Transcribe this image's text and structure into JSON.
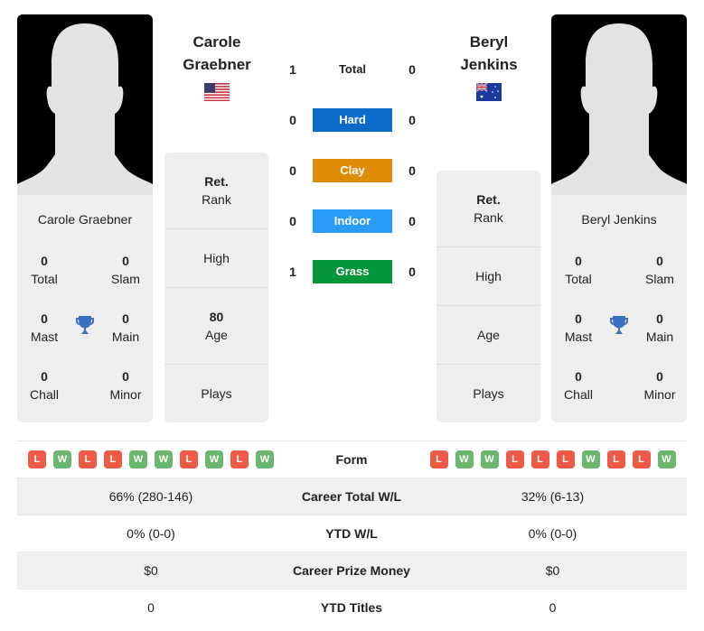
{
  "players": {
    "left": {
      "name": "Carole Graebner",
      "name_line1": "Carole",
      "name_line2": "Graebner",
      "flag": "us-flag",
      "titles": {
        "total": {
          "value": "0",
          "label": "Total"
        },
        "slam": {
          "value": "0",
          "label": "Slam"
        },
        "mast": {
          "value": "0",
          "label": "Mast"
        },
        "main": {
          "value": "0",
          "label": "Main"
        },
        "chall": {
          "value": "0",
          "label": "Chall"
        },
        "minor": {
          "value": "0",
          "label": "Minor"
        }
      },
      "info": {
        "rank_value": "Ret.",
        "rank_label": "Rank",
        "high_label": "High",
        "age_value": "80",
        "age_label": "Age",
        "plays_label": "Plays"
      },
      "form": [
        "L",
        "W",
        "L",
        "L",
        "W",
        "W",
        "L",
        "W",
        "L",
        "W"
      ]
    },
    "right": {
      "name": "Beryl Jenkins",
      "name_line1": "Beryl",
      "name_line2": "Jenkins",
      "flag": "australia-flag",
      "titles": {
        "total": {
          "value": "0",
          "label": "Total"
        },
        "slam": {
          "value": "0",
          "label": "Slam"
        },
        "mast": {
          "value": "0",
          "label": "Mast"
        },
        "main": {
          "value": "0",
          "label": "Main"
        },
        "chall": {
          "value": "0",
          "label": "Chall"
        },
        "minor": {
          "value": "0",
          "label": "Minor"
        }
      },
      "info": {
        "rank_value": "Ret.",
        "rank_label": "Rank",
        "high_label": "High",
        "age_label": "Age",
        "plays_label": "Plays"
      },
      "form": [
        "L",
        "W",
        "W",
        "L",
        "L",
        "L",
        "W",
        "L",
        "L",
        "W"
      ]
    }
  },
  "h2h": [
    {
      "label": "Total",
      "left": "1",
      "right": "0",
      "color": ""
    },
    {
      "label": "Hard",
      "left": "0",
      "right": "0",
      "color": "#0a6cc7"
    },
    {
      "label": "Clay",
      "left": "0",
      "right": "0",
      "color": "#de8d09"
    },
    {
      "label": "Indoor",
      "left": "0",
      "right": "0",
      "color": "#2b9cf5"
    },
    {
      "label": "Grass",
      "left": "1",
      "right": "0",
      "color": "#06963a"
    }
  ],
  "stats": {
    "form_label": "Form",
    "rows": [
      {
        "label": "Career Total W/L",
        "left": "66% (280-146)",
        "right": "32% (6-13)"
      },
      {
        "label": "YTD W/L",
        "left": "0% (0-0)",
        "right": "0% (0-0)"
      },
      {
        "label": "Career Prize Money",
        "left": "$0",
        "right": "$0"
      },
      {
        "label": "YTD Titles",
        "left": "0",
        "right": "0"
      }
    ]
  },
  "colors": {
    "win": "#6ab86e",
    "loss": "#ee5a45",
    "trophy": "#3a6fc2"
  }
}
